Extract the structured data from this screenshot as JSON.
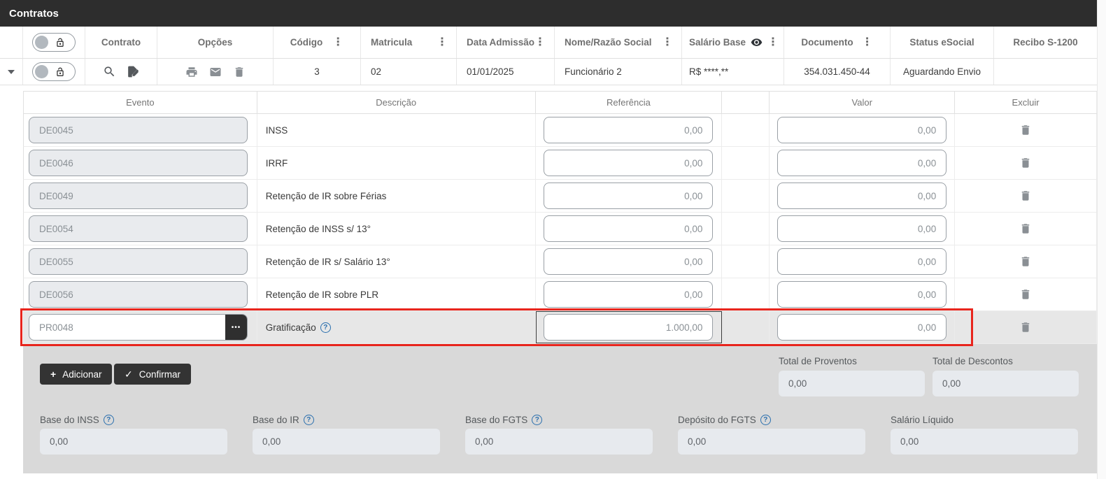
{
  "titlebar": {
    "title": "Contratos"
  },
  "contracts": {
    "columns": {
      "contrato": "Contrato",
      "opcoes": "Opções",
      "codigo": "Código",
      "matricula": "Matricula",
      "data_admissao": "Data Admissão",
      "nome": "Nome/Razão Social",
      "salario": "Salário Base",
      "documento": "Documento",
      "status": "Status eSocial",
      "recibo": "Recibo S-1200"
    },
    "row": {
      "codigo": "3",
      "matricula": "02",
      "data_admissao": "01/01/2025",
      "nome": "Funcionário 2",
      "salario": "R$ ****,**",
      "documento": "354.031.450-44",
      "status": "Aguardando Envio",
      "recibo": ""
    }
  },
  "events": {
    "headers": {
      "evento": "Evento",
      "descricao": "Descrição",
      "referencia": "Referência",
      "valor": "Valor",
      "excluir": "Excluir"
    },
    "rows": [
      {
        "code": "DE0045",
        "desc": "INSS",
        "ref": "0,00",
        "val": "0,00"
      },
      {
        "code": "DE0046",
        "desc": "IRRF",
        "ref": "0,00",
        "val": "0,00"
      },
      {
        "code": "DE0049",
        "desc": "Retenção de IR sobre Férias",
        "ref": "0,00",
        "val": "0,00"
      },
      {
        "code": "DE0054",
        "desc": "Retenção de INSS s/ 13°",
        "ref": "0,00",
        "val": "0,00"
      },
      {
        "code": "DE0055",
        "desc": "Retenção de IR s/ Salário 13°",
        "ref": "0,00",
        "val": "0,00"
      },
      {
        "code": "DE0056",
        "desc": "Retenção de IR sobre PLR",
        "ref": "0,00",
        "val": "0,00"
      },
      {
        "code": "PR0048",
        "desc": "Gratificação",
        "ref": "1.000,00",
        "val": "0,00",
        "highlighted": true
      }
    ]
  },
  "footer": {
    "add_label": "Adicionar",
    "confirm_label": "Confirmar",
    "total_proventos_label": "Total de Proventos",
    "total_proventos_value": "0,00",
    "total_descontos_label": "Total de Descontos",
    "total_descontos_value": "0,00",
    "bases": [
      {
        "label": "Base do INSS",
        "value": "0,00"
      },
      {
        "label": "Base do IR",
        "value": "0,00"
      },
      {
        "label": "Base do FGTS",
        "value": "0,00"
      },
      {
        "label": "Depósito do FGTS",
        "value": "0,00"
      },
      {
        "label": "Salário Líquido",
        "value": "0,00"
      }
    ]
  },
  "icons": {
    "menu_dots": "⋮",
    "ellipsis": "•••",
    "help": "?",
    "plus": "+",
    "check": "✓"
  },
  "colors": {
    "highlight_red": "#e8251d",
    "button_dark": "#333333",
    "help_blue": "#2a6fae",
    "titlebar_dark": "#2d2d2d",
    "footer_gray": "#d9d9d9"
  }
}
